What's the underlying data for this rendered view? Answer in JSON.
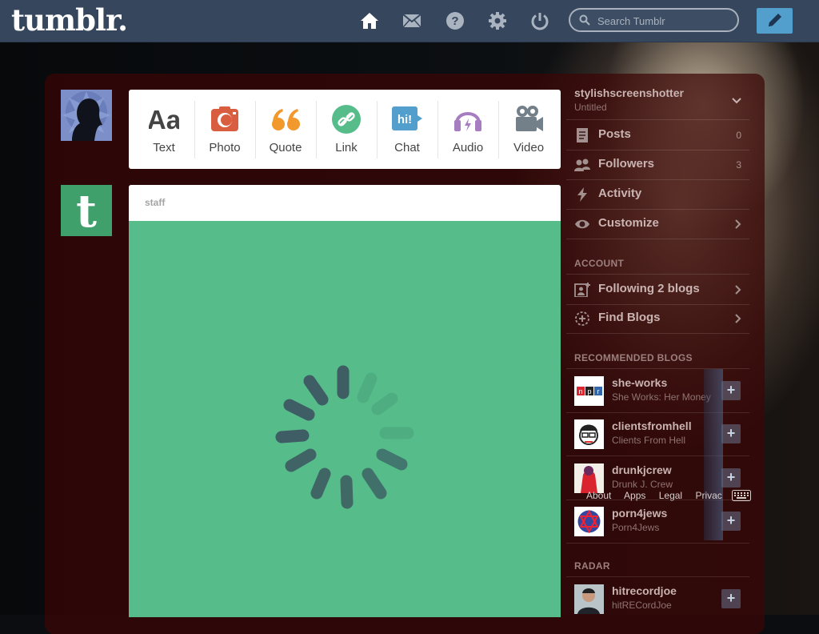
{
  "header": {
    "logo": "tumblr.",
    "search_placeholder": "Search Tumblr",
    "nav_icons": [
      "home-icon",
      "mail-icon",
      "help-icon",
      "settings-icon",
      "power-icon"
    ],
    "brand_color": "#36465d",
    "compose_color": "#529ecc"
  },
  "post_types": [
    {
      "label": "Text",
      "icon": "text-icon",
      "color": "#444444"
    },
    {
      "label": "Photo",
      "icon": "camera-icon",
      "color": "#d95e40"
    },
    {
      "label": "Quote",
      "icon": "quote-icon",
      "color": "#f2992e"
    },
    {
      "label": "Link",
      "icon": "link-icon",
      "color": "#56bc8a"
    },
    {
      "label": "Chat",
      "icon": "chat-icon",
      "color": "#529ecc"
    },
    {
      "label": "Audio",
      "icon": "headphones-icon",
      "color": "#a77dc2"
    },
    {
      "label": "Video",
      "icon": "video-camera-icon",
      "color": "#748089"
    }
  ],
  "post": {
    "author": "staff",
    "background_color": "#56bc8a",
    "state": "loading"
  },
  "sidebar": {
    "blog": {
      "name": "stylishscreenshotter",
      "title": "Untitled"
    },
    "menu": [
      {
        "label": "Posts",
        "count": "0",
        "icon": "posts-icon"
      },
      {
        "label": "Followers",
        "count": "3",
        "icon": "followers-icon"
      },
      {
        "label": "Activity",
        "count": "",
        "icon": "lightning-icon"
      },
      {
        "label": "Customize",
        "count": "",
        "icon": "eye-icon"
      }
    ],
    "account_heading": "ACCOUNT",
    "account": [
      {
        "label": "Following 2 blogs",
        "icon": "following-icon"
      },
      {
        "label": "Find Blogs",
        "icon": "compass-icon"
      }
    ],
    "recommended_heading": "RECOMMENDED BLOGS",
    "recommended": [
      {
        "name": "she-works",
        "subtitle": "She Works: Her Money"
      },
      {
        "name": "clientsfromhell",
        "subtitle": "Clients From Hell"
      },
      {
        "name": "drunkjcrew",
        "subtitle": "Drunk J. Crew"
      },
      {
        "name": "porn4jews",
        "subtitle": "Porn4Jews"
      }
    ],
    "radar_heading": "RADAR",
    "radar": [
      {
        "name": "hitrecordjoe",
        "subtitle": "hitRECordJoe"
      }
    ]
  },
  "footer": {
    "links": [
      "About",
      "Apps",
      "Legal",
      "Privac"
    ]
  }
}
